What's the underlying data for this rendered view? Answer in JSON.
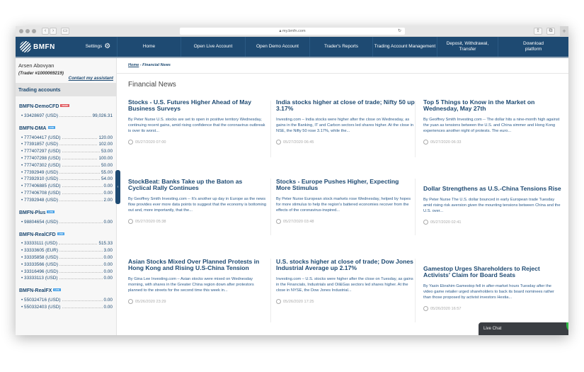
{
  "browser": {
    "url": "my.bmfn.com"
  },
  "nav": {
    "logo": "BMFN",
    "settings": "Settings",
    "items": [
      "Home",
      "Open Live Account",
      "Open Demo Account",
      "Trader's Reports",
      "Trading Account Management",
      "Deposit, Withdrawal, Transfer",
      "Download platform"
    ]
  },
  "user": {
    "name": "Arsen Abovyan",
    "trader": "(Trader #1000069219)",
    "contact": "Contact my assistant"
  },
  "sidebar": {
    "title": "Trading accounts",
    "groups": [
      {
        "name": "BMFN-DemoCFD",
        "badge": "DEMO",
        "badge_color": "#e0545a",
        "accounts": [
          {
            "id": "33428697 (USD)",
            "balance": "99,026.31"
          }
        ]
      },
      {
        "name": "BMFN-DMA",
        "badge": "LIVE",
        "badge_color": "#4aa3e8",
        "accounts": [
          {
            "id": "777404417 (USD)",
            "balance": "120.00"
          },
          {
            "id": "77391857 (USD)",
            "balance": "102.00"
          },
          {
            "id": "777407297 (USD)",
            "balance": "53.00"
          },
          {
            "id": "777407298 (USD)",
            "balance": "100.00"
          },
          {
            "id": "777407302 (USD)",
            "balance": "50.00"
          },
          {
            "id": "77392949 (USD)",
            "balance": "55.00"
          },
          {
            "id": "77392910 (USD)",
            "balance": "54.00"
          },
          {
            "id": "777406885 (USD)",
            "balance": "0.00"
          },
          {
            "id": "777406708 (USD)",
            "balance": "0.00"
          },
          {
            "id": "77392948 (USD)",
            "balance": "2.00"
          }
        ]
      },
      {
        "name": "BMFN-Plus",
        "badge": "LIVE",
        "badge_color": "#4aa3e8",
        "accounts": [
          {
            "id": "98804654 (USD)",
            "balance": "0.00"
          }
        ]
      },
      {
        "name": "BMFN-RealCFD",
        "badge": "LIVE",
        "badge_color": "#4aa3e8",
        "accounts": [
          {
            "id": "33333111 (USD)",
            "balance": "515.33"
          },
          {
            "id": "33333605 (EUR)",
            "balance": "3.00"
          },
          {
            "id": "33335858 (USD)",
            "balance": "0.00"
          },
          {
            "id": "33333566 (USD)",
            "balance": "0.00"
          },
          {
            "id": "33316496 (USD)",
            "balance": "0.00"
          },
          {
            "id": "33333113 (USD)",
            "balance": "0.00"
          }
        ]
      },
      {
        "name": "BMFN-RealFX",
        "badge": "LIVE",
        "badge_color": "#4aa3e8",
        "accounts": [
          {
            "id": "550324716 (USD)",
            "balance": "0.00"
          },
          {
            "id": "550332403 (USD)",
            "balance": "0.00"
          }
        ]
      }
    ]
  },
  "breadcrumb": {
    "home": "Home",
    "current": " - Financial News"
  },
  "page_title": "Financial News",
  "news": [
    {
      "title": "Stocks - U.S. Futures Higher Ahead of May Business Surveys",
      "summary": "By Peter Nurse    U.S. stocks are set to open in positive territory Wednesday, continuing recent gains, amid rising confidence that the coronavirus outbreak is over its worst...",
      "date": "05/27/2020 07:00"
    },
    {
      "title": "India stocks higher at close of trade; Nifty 50 up 3.17%",
      "summary": "Investing.com – India stocks were higher after the close on Wednesday, as gains in the Banking, IT and Carbon sectors led shares higher. At the close in NSE, the Nifty 50 rose 3.17%, while the...",
      "date": "05/27/2020 06:45"
    },
    {
      "title": "Top 5 Things to Know in the Market on Wednesday, May 27th",
      "summary": "By Geoffrey Smith  Investing.com -- The dollar hits a nine-month high against the yuan as tensions between the U.S. and China simmer and Hong Kong experiences another night of protests. The euro...",
      "date": "05/27/2020 06:33"
    },
    {
      "title": "StockBeat: Banks Take up the Baton as Cyclical Rally Continues",
      "summary": "By Geoffrey Smith  Investing.com -- It's another up day in Europe as the news flow provides ever more data points to suggest that the economy is bottoming out and, more importantly, that the...",
      "date": "05/27/2020 05:38"
    },
    {
      "title": "Stocks - Europe Pushes Higher, Expecting More Stimulus",
      "summary": "By Peter Nurse  European stock markets rose Wednesday, helped by hopes for more stimulus to help the region's battered economies recover from the effects of the coronavirus-inspired...",
      "date": "05/27/2020 03:48"
    },
    {
      "title": "Dollar Strengthens as U.S.-China Tensions Rise",
      "summary": "By Peter Nurse  The U.S. dollar bounced in early European trade Tuesday amid rising risk aversion given the mounting tensions between China and the U.S. over...",
      "date": "05/27/2020 02:41"
    },
    {
      "title": "Asian Stocks Mixed Over Planned Protests in Hong Kong and Rising U.S-China Tension",
      "summary": "By Gina Lee Investing.com – Asian stocks were mixed on Wednesday morning, with shares in the Greater China region down after protestors planned to the streets for the second time this week in...",
      "date": "05/26/2020 23:29"
    },
    {
      "title": "U.S. stocks higher at close of trade; Dow Jones Industrial Average up 2.17%",
      "summary": "Investing.com – U.S. stocks were higher after the close on Tuesday, as gains in the Financials, Industrials and Oil&Gas sectors led shares higher. At the close in NYSE, the Dow Jones Industrial...",
      "date": "05/26/2020 17:25"
    },
    {
      "title": "Gamestop Urges Shareholders to Reject Activists' Claim for Board Seats",
      "summary": "By Yasin Ebrahim  Gamestop fell in after-market hours Tuesday after the video game retailer urged shareholders to back its board nominees rather than those proposed by activist investors Hestia...",
      "date": "05/26/2020 16:57"
    }
  ],
  "live_chat": "Live Chat"
}
